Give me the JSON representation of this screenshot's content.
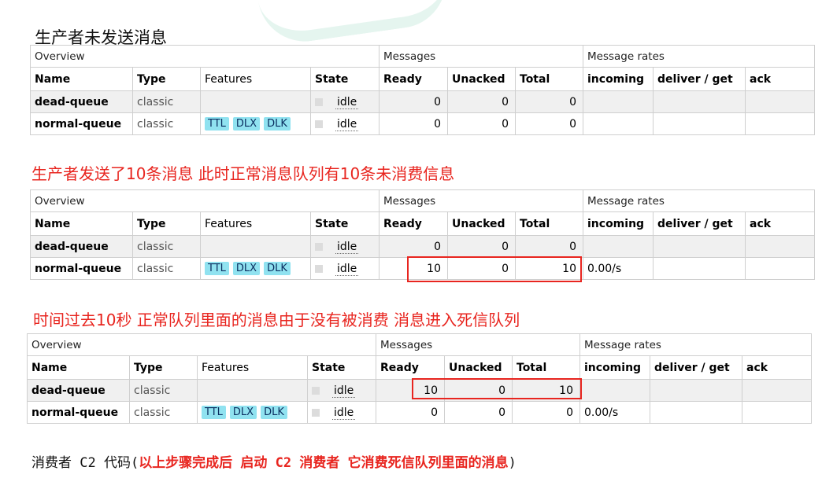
{
  "sections": [
    {
      "heading": "生产者未发送消息",
      "overview_label": "Overview",
      "messages_label": "Messages",
      "rates_label": "Message rates",
      "columns": [
        "Name",
        "Type",
        "Features",
        "State",
        "Ready",
        "Unacked",
        "Total",
        "incoming",
        "deliver / get",
        "ack"
      ],
      "rows": [
        {
          "name": "dead-queue",
          "type": "classic",
          "features": [],
          "state": "idle",
          "ready": "0",
          "unacked": "0",
          "total": "0",
          "incoming": "",
          "deliver": "",
          "ack": ""
        },
        {
          "name": "normal-queue",
          "type": "classic",
          "features": [
            "TTL",
            "DLX",
            "DLK"
          ],
          "state": "idle",
          "ready": "0",
          "unacked": "0",
          "total": "0",
          "incoming": "",
          "deliver": "",
          "ack": ""
        }
      ]
    },
    {
      "heading": "生产者发送了10条消息 此时正常消息队列有10条未消费信息",
      "overview_label": "Overview",
      "messages_label": "Messages",
      "rates_label": "Message rates",
      "columns": [
        "Name",
        "Type",
        "Features",
        "State",
        "Ready",
        "Unacked",
        "Total",
        "incoming",
        "deliver / get",
        "ack"
      ],
      "rows": [
        {
          "name": "dead-queue",
          "type": "classic",
          "features": [],
          "state": "idle",
          "ready": "0",
          "unacked": "0",
          "total": "0",
          "incoming": "",
          "deliver": "",
          "ack": ""
        },
        {
          "name": "normal-queue",
          "type": "classic",
          "features": [
            "TTL",
            "DLX",
            "DLK"
          ],
          "state": "idle",
          "ready": "10",
          "unacked": "0",
          "total": "10",
          "incoming": "0.00/s",
          "deliver": "",
          "ack": ""
        }
      ]
    },
    {
      "heading": "时间过去10秒  正常队列里面的消息由于没有被消费 消息进入死信队列",
      "overview_label": "Overview",
      "messages_label": "Messages",
      "rates_label": "Message rates",
      "columns": [
        "Name",
        "Type",
        "Features",
        "State",
        "Ready",
        "Unacked",
        "Total",
        "incoming",
        "deliver / get",
        "ack"
      ],
      "rows": [
        {
          "name": "dead-queue",
          "type": "classic",
          "features": [],
          "state": "idle",
          "ready": "10",
          "unacked": "0",
          "total": "10",
          "incoming": "",
          "deliver": "",
          "ack": ""
        },
        {
          "name": "normal-queue",
          "type": "classic",
          "features": [
            "TTL",
            "DLX",
            "DLK"
          ],
          "state": "idle",
          "ready": "0",
          "unacked": "0",
          "total": "0",
          "incoming": "0.00/s",
          "deliver": "",
          "ack": ""
        }
      ]
    }
  ],
  "consumer_note": {
    "prefix": "消费者 C2 代码(",
    "highlight": "以上步骤完成后 启动 C2 消费者 它消费死信队列里面的消息",
    "suffix": ")"
  },
  "colors": {
    "accent_red": "#e8251f",
    "feature_badge": "#90e2f0"
  }
}
